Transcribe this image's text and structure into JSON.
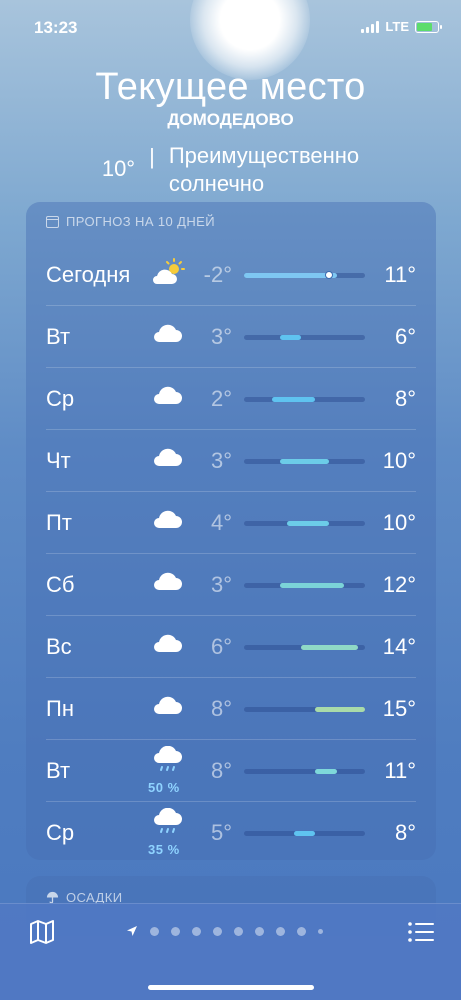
{
  "status_bar": {
    "time": "13:23",
    "network": "LTE"
  },
  "header": {
    "place": "Текущее место",
    "city": "ДОМОДЕДОВО",
    "temp": "10°",
    "separator": "|",
    "condition_line1": "Преимущественно",
    "condition_line2": "солнечно"
  },
  "forecast": {
    "title": "ПРОГНОЗ НА 10 ДНЕЙ",
    "icon": "calendar-icon",
    "range_min": -2,
    "range_max": 15,
    "current_temp": 10,
    "days": [
      {
        "day": "Сегодня",
        "icon": "partly-sunny-icon",
        "precip": "",
        "low": "-2°",
        "high": "11°",
        "lo_val": -2,
        "hi_val": 11,
        "bar_color": "#7ec7f2",
        "current": true
      },
      {
        "day": "Вт",
        "icon": "cloud-icon",
        "precip": "",
        "low": "3°",
        "high": "6°",
        "lo_val": 3,
        "hi_val": 6,
        "bar_color": "#5fc3f0"
      },
      {
        "day": "Ср",
        "icon": "cloud-icon",
        "precip": "",
        "low": "2°",
        "high": "8°",
        "lo_val": 2,
        "hi_val": 8,
        "bar_color": "#5fc3f0"
      },
      {
        "day": "Чт",
        "icon": "cloud-icon",
        "precip": "",
        "low": "3°",
        "high": "10°",
        "lo_val": 3,
        "hi_val": 10,
        "bar_color": "#6ccce8"
      },
      {
        "day": "Пт",
        "icon": "cloud-icon",
        "precip": "",
        "low": "4°",
        "high": "10°",
        "lo_val": 4,
        "hi_val": 10,
        "bar_color": "#6ccce8"
      },
      {
        "day": "Сб",
        "icon": "cloud-icon",
        "precip": "",
        "low": "3°",
        "high": "12°",
        "lo_val": 3,
        "hi_val": 12,
        "bar_color": "#7bd3d8"
      },
      {
        "day": "Вс",
        "icon": "cloud-icon",
        "precip": "",
        "low": "6°",
        "high": "14°",
        "lo_val": 6,
        "hi_val": 14,
        "bar_color": "#8fd9c6"
      },
      {
        "day": "Пн",
        "icon": "cloud-icon",
        "precip": "",
        "low": "8°",
        "high": "15°",
        "lo_val": 8,
        "hi_val": 15,
        "bar_color": "#a9dba9"
      },
      {
        "day": "Вт",
        "icon": "rain-cloud-icon",
        "precip": "50 %",
        "low": "8°",
        "high": "11°",
        "lo_val": 8,
        "hi_val": 11,
        "bar_color": "#7ed8da"
      },
      {
        "day": "Ср",
        "icon": "rain-cloud-icon",
        "precip": "35 %",
        "low": "5°",
        "high": "8°",
        "lo_val": 5,
        "hi_val": 8,
        "bar_color": "#5fc3f0"
      }
    ]
  },
  "precip_card": {
    "title": "ОСАДКИ",
    "icon": "umbrella-icon"
  },
  "tabbar": {
    "map_icon": "map-icon",
    "location_icon": "location-arrow-icon",
    "page_count": 10,
    "list_icon": "list-icon"
  }
}
